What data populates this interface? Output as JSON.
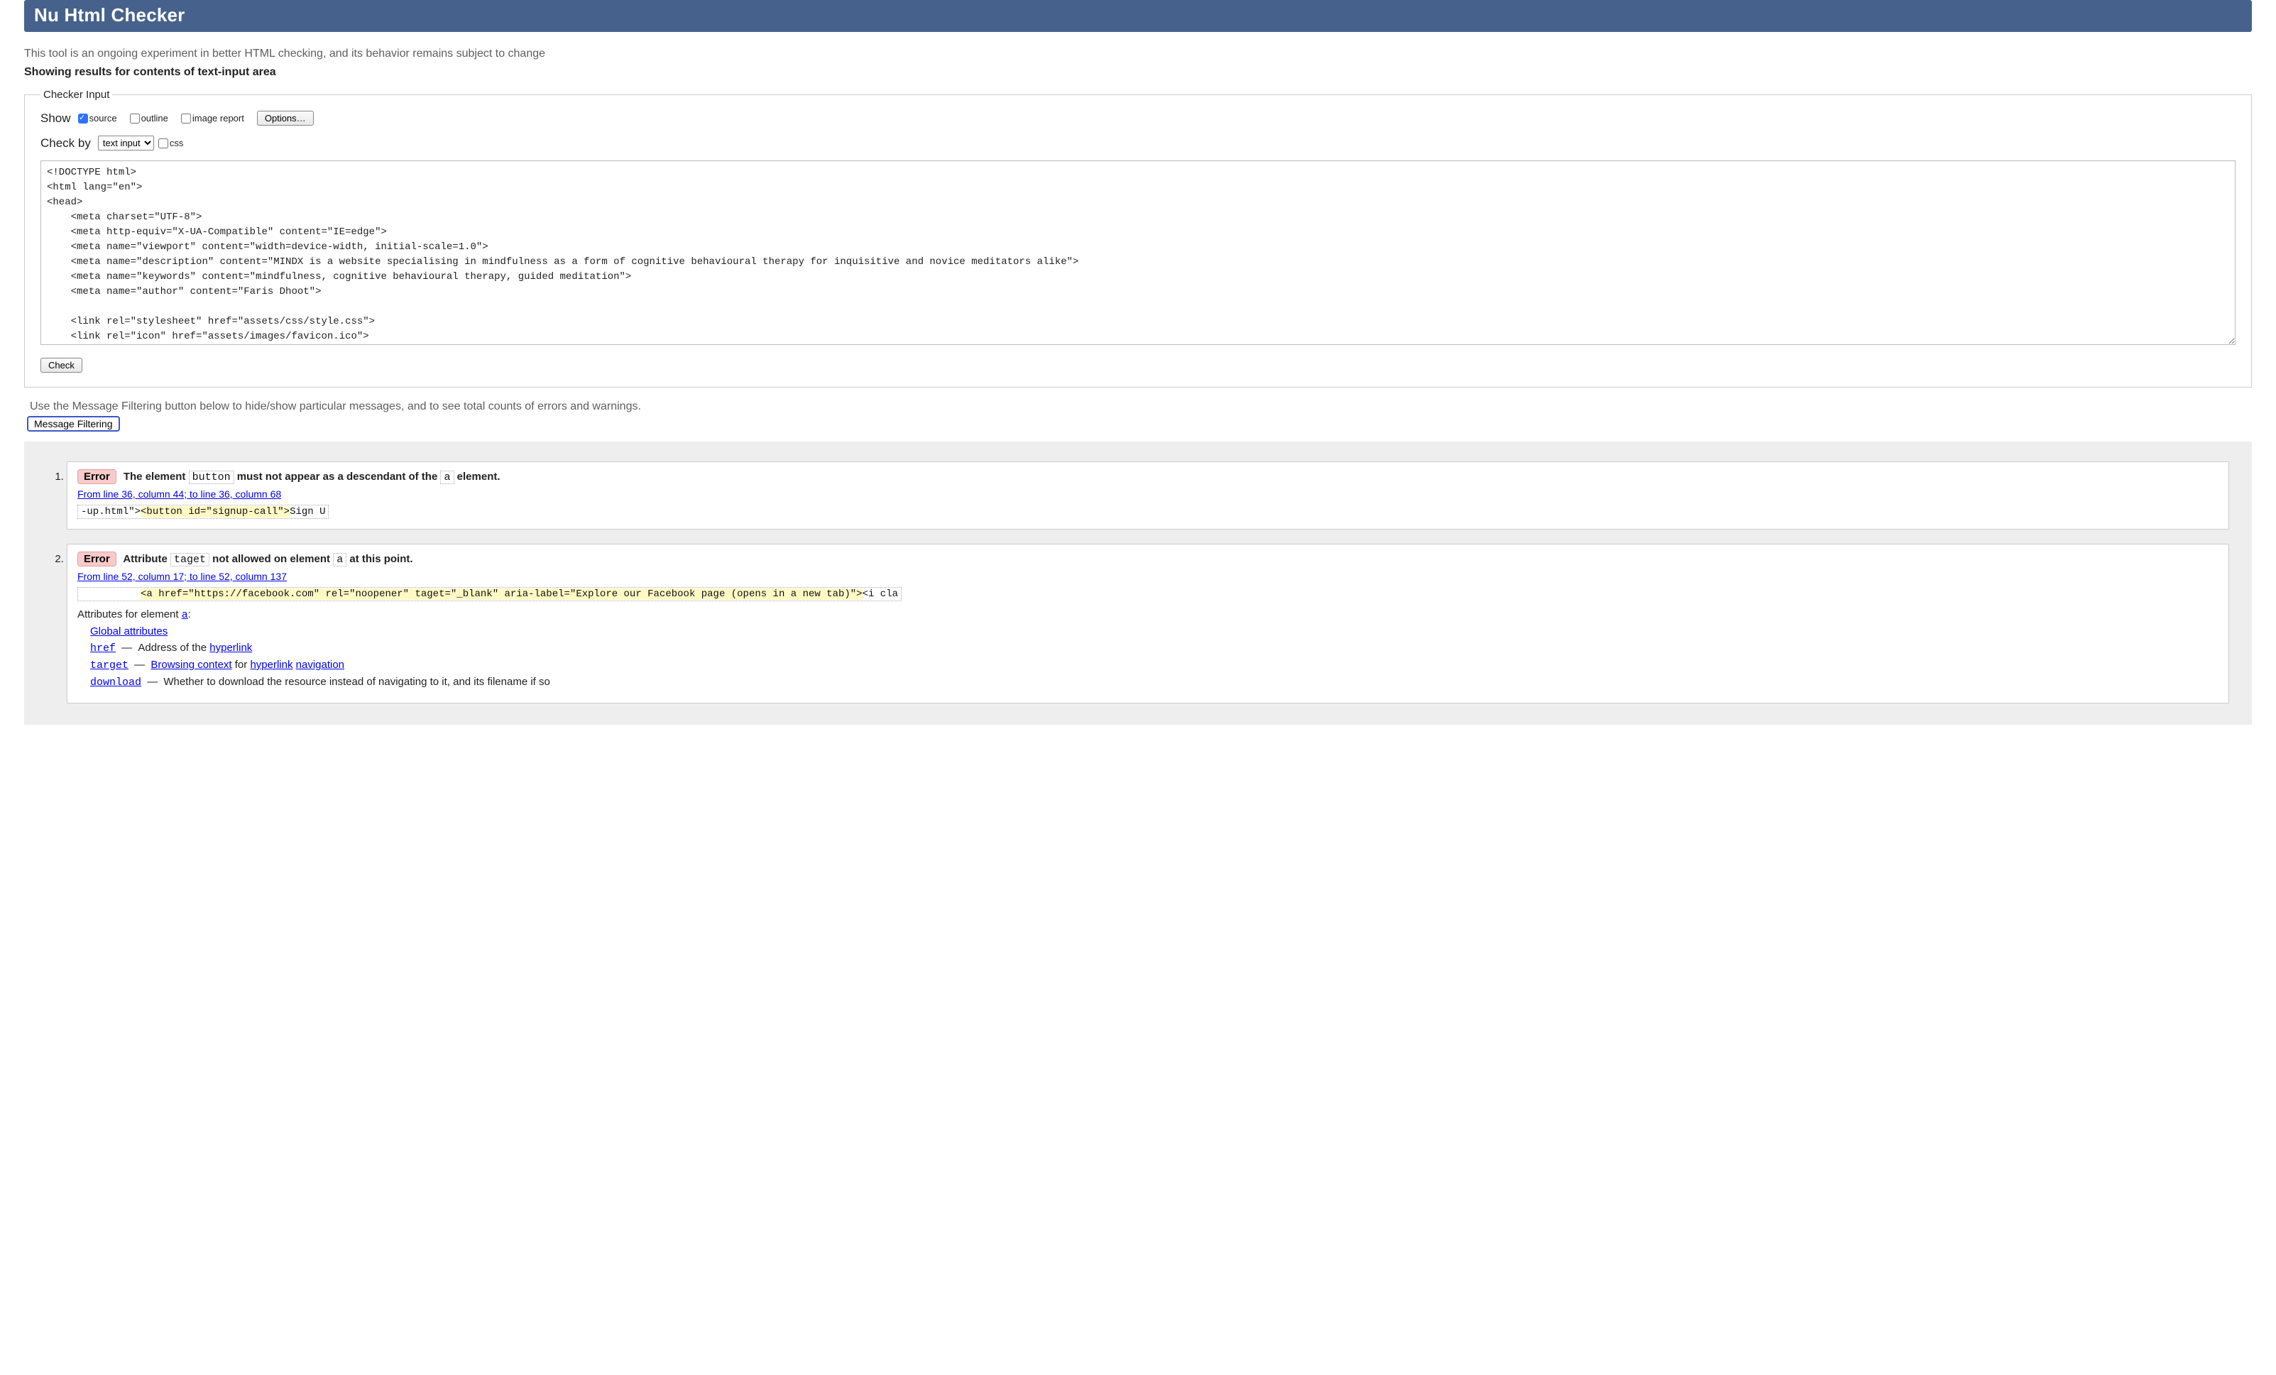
{
  "header": {
    "title": "Nu Html Checker"
  },
  "intro": "This tool is an ongoing experiment in better HTML checking, and its behavior remains subject to change",
  "results_heading": "Showing results for contents of text-input area",
  "fieldset": {
    "legend": "Checker Input",
    "show_label": "Show",
    "source_label": "source",
    "outline_label": "outline",
    "image_report_label": "image report",
    "options_button": "Options…",
    "checkby_label": "Check by",
    "checkby_value": "text input",
    "css_label": "css",
    "check_button": "Check",
    "source_text": "<!DOCTYPE html>\n<html lang=\"en\">\n<head>\n    <meta charset=\"UTF-8\">\n    <meta http-equiv=\"X-UA-Compatible\" content=\"IE=edge\">\n    <meta name=\"viewport\" content=\"width=device-width, initial-scale=1.0\">\n    <meta name=\"description\" content=\"MINDX is a website specialising in mindfulness as a form of cognitive behavioural therapy for inquisitive and novice meditators alike\">\n    <meta name=\"keywords\" content=\"mindfulness, cognitive behavioural therapy, guided meditation\">\n    <meta name=\"author\" content=\"Faris Dhoot\">\n\n    <link rel=\"stylesheet\" href=\"assets/css/style.css\">\n    <link rel=\"icon\" href=\"assets/images/favicon.ico\">\n    <link rel=\"stylesheet\" href=\"https://fonts.googleapis.com/icon?family=Material+Icons\">"
  },
  "filter_note": "Use the Message Filtering button below to hide/show particular messages, and to see total counts of errors and warnings.",
  "filter_button": "Message Filtering",
  "messages": [
    {
      "badge": "Error",
      "title_pre": "The element ",
      "title_code1": "button",
      "title_mid": " must not appear as a descendant of the ",
      "title_code2": "a",
      "title_post": " element.",
      "location": "From line 36, column 44; to line 36, column 68",
      "snippet_pre": "-up.html\">",
      "snippet_hi": "<button id=\"signup-call\">",
      "snippet_post": "Sign U"
    },
    {
      "badge": "Error",
      "title_pre": "Attribute ",
      "title_code1": "taget",
      "title_mid": " not allowed on element ",
      "title_code2": "a",
      "title_post": " at this point.",
      "location": "From line 52, column 17; to line 52, column 137",
      "snippet_pre": "          ",
      "snippet_hi": "<a href=\"https://facebook.com\" rel=\"noopener\" taget=\"_blank\" aria-label=\"Explore our Facebook page (opens in a new tab)\">",
      "snippet_post": "<i cla",
      "attr_intro_pre": "Attributes for element ",
      "attr_intro_code": "a",
      "attr_intro_post": ":",
      "attrs": {
        "global": "Global attributes",
        "href": {
          "name": "href",
          "dash": " — ",
          "desc_pre": "Address of the ",
          "link": "hyperlink",
          "desc_post": ""
        },
        "target": {
          "name": "target",
          "dash": " — ",
          "link1": "Browsing context",
          "mid": " for ",
          "link2": "hyperlink",
          "space": " ",
          "link3": "navigation"
        },
        "download": {
          "name": "download",
          "dash": " — ",
          "desc": "Whether to download the resource instead of navigating to it, and its filename if so"
        }
      }
    }
  ]
}
